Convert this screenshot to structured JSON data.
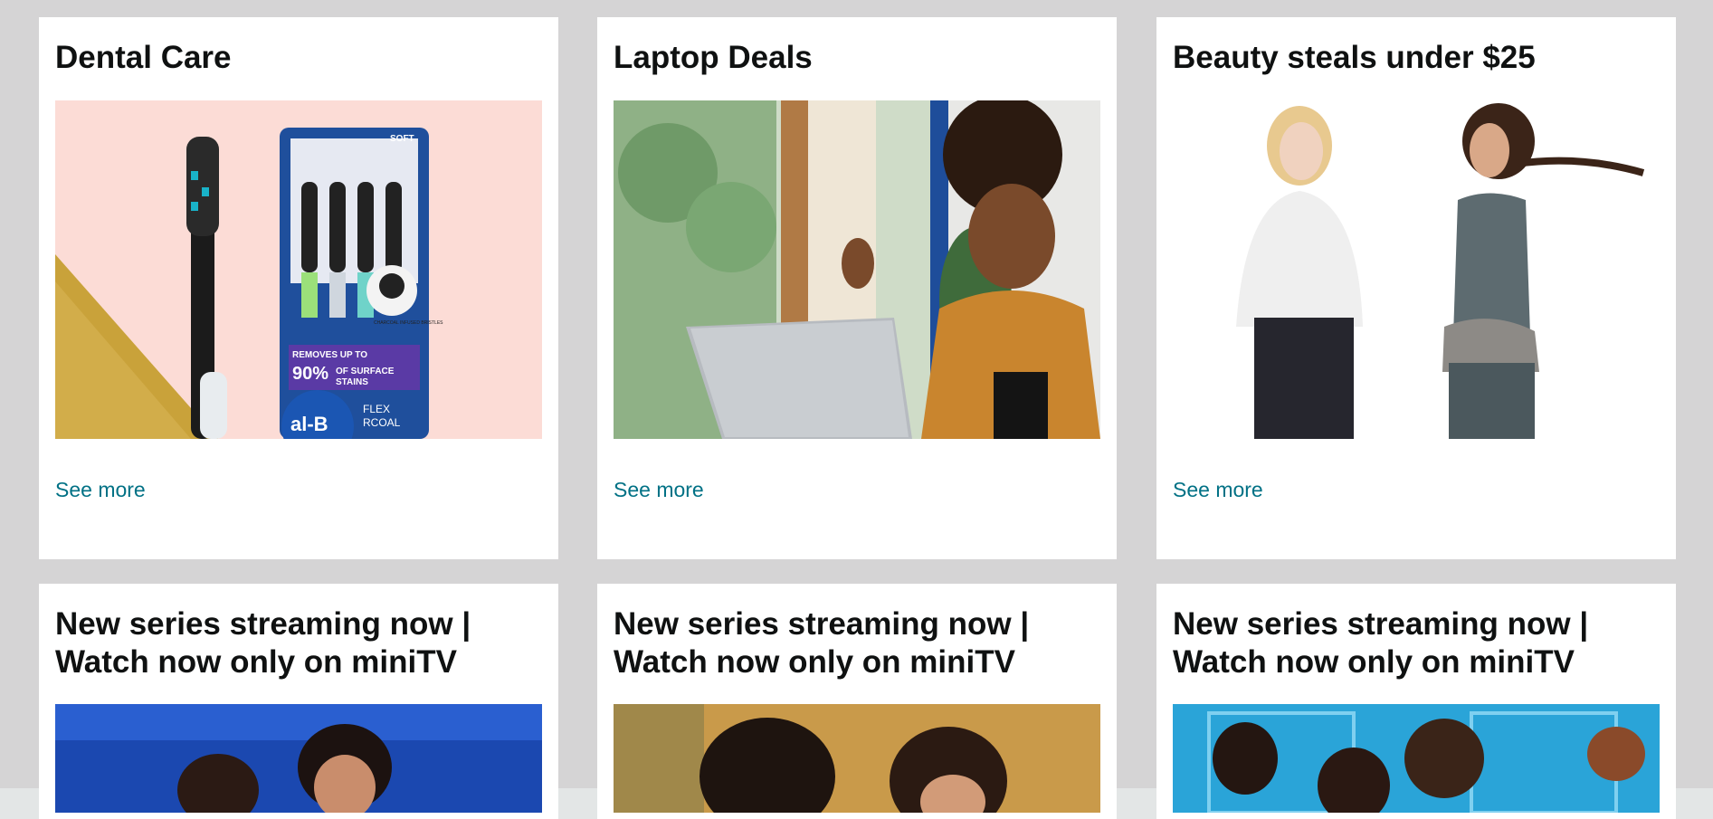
{
  "cards": [
    {
      "title": "Dental Care",
      "link": "See more",
      "image": "toothbrush-product-image"
    },
    {
      "title": "Laptop Deals",
      "link": "See more",
      "image": "woman-with-laptop-image"
    },
    {
      "title": "Beauty steals under $25",
      "link": "See more",
      "image": "two-women-fashion-image"
    },
    {
      "title": "New series streaming now | Watch now only on miniTV",
      "image": "series-poster-image"
    },
    {
      "title": "New series streaming now | Watch now only on miniTV",
      "image": "series-poster-image"
    },
    {
      "title": "New series streaming now | Watch now only on miniTV",
      "image": "series-poster-image"
    }
  ],
  "product_text": {
    "soft": "SOFT",
    "removes": "REMOVES UP TO",
    "percent": "90%",
    "surface": "OF SURFACE",
    "stains": "STAINS",
    "charcoal": "CHARCOAL INFUSED BRISTLES",
    "brand": "al-B",
    "flex": "FLEX",
    "coal": "RCOAL"
  },
  "colors": {
    "page_bg": "#d5d4d5",
    "card_bg": "#ffffff",
    "link": "#007185",
    "title": "#0f1111"
  }
}
